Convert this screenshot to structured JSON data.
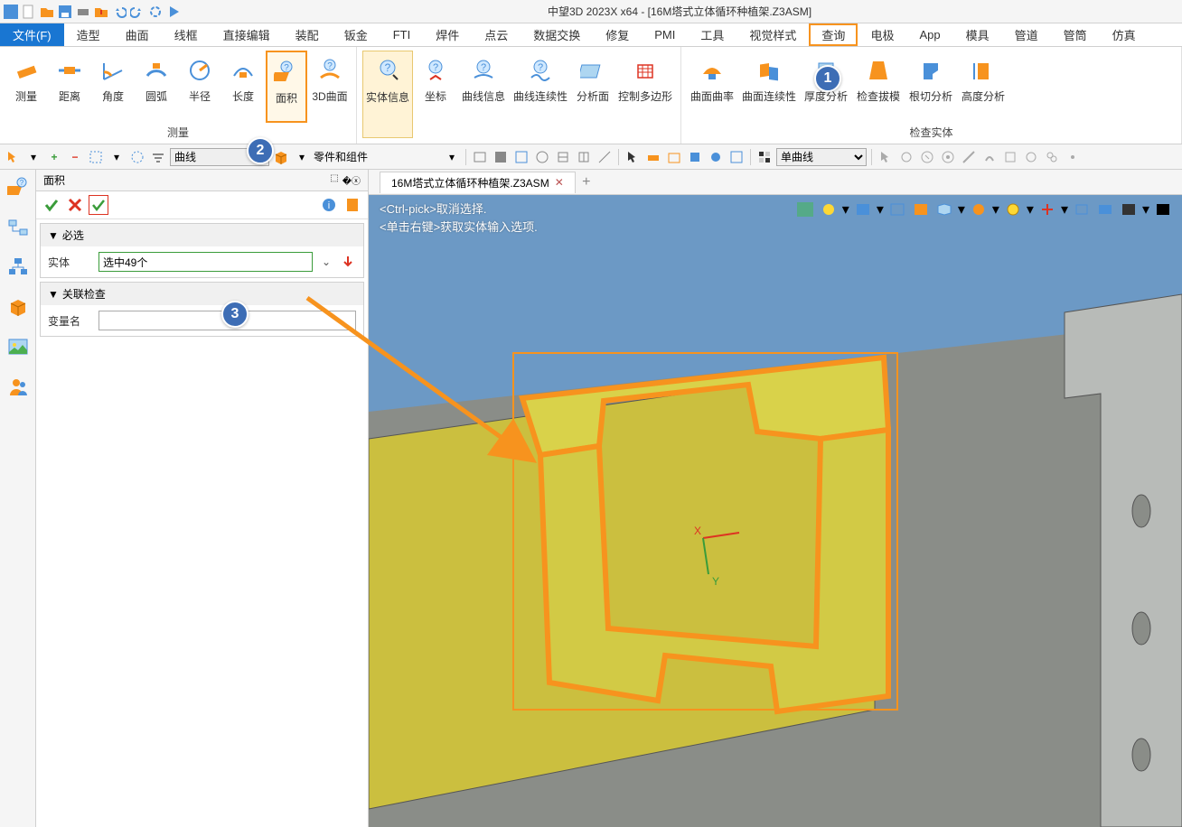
{
  "app": {
    "title": "中望3D 2023X x64 - [16M塔式立体循环种植架.Z3ASM]"
  },
  "menu": {
    "file": "文件(F)",
    "items": [
      "造型",
      "曲面",
      "线框",
      "直接编辑",
      "装配",
      "钣金",
      "FTI",
      "焊件",
      "点云",
      "数据交换",
      "修复",
      "PMI",
      "工具",
      "视觉样式",
      "查询",
      "电极",
      "App",
      "模具",
      "管道",
      "管筒",
      "仿真"
    ]
  },
  "ribbon": {
    "group1_label": "测量",
    "group1": [
      "测量",
      "距离",
      "角度",
      "圆弧",
      "半径",
      "长度",
      "面积",
      "3D曲面"
    ],
    "group2": [
      "实体信息",
      "坐标",
      "曲线信息",
      "曲线连续性",
      "分析面",
      "控制多边形"
    ],
    "group3_label": "检查实体",
    "group3": [
      "曲面曲率",
      "曲面连续性",
      "厚度分析",
      "检查拔模",
      "根切分析",
      "高度分析"
    ]
  },
  "toolbar": {
    "select1": "曲线",
    "select1_label": "零件和组件",
    "select2": "单曲线"
  },
  "panel": {
    "title": "面积",
    "section_required": "必选",
    "field_entity": "实体",
    "field_entity_value": "选中49个",
    "section_assoc": "关联检查",
    "field_varname": "变量名"
  },
  "tab": {
    "name": "16M塔式立体循环种植架.Z3ASM"
  },
  "hints": {
    "line1": "<Ctrl-pick>取消选择.",
    "line2": "<单击右键>获取实体输入选项."
  },
  "callouts": {
    "c1": "1",
    "c2": "2",
    "c3": "3"
  }
}
